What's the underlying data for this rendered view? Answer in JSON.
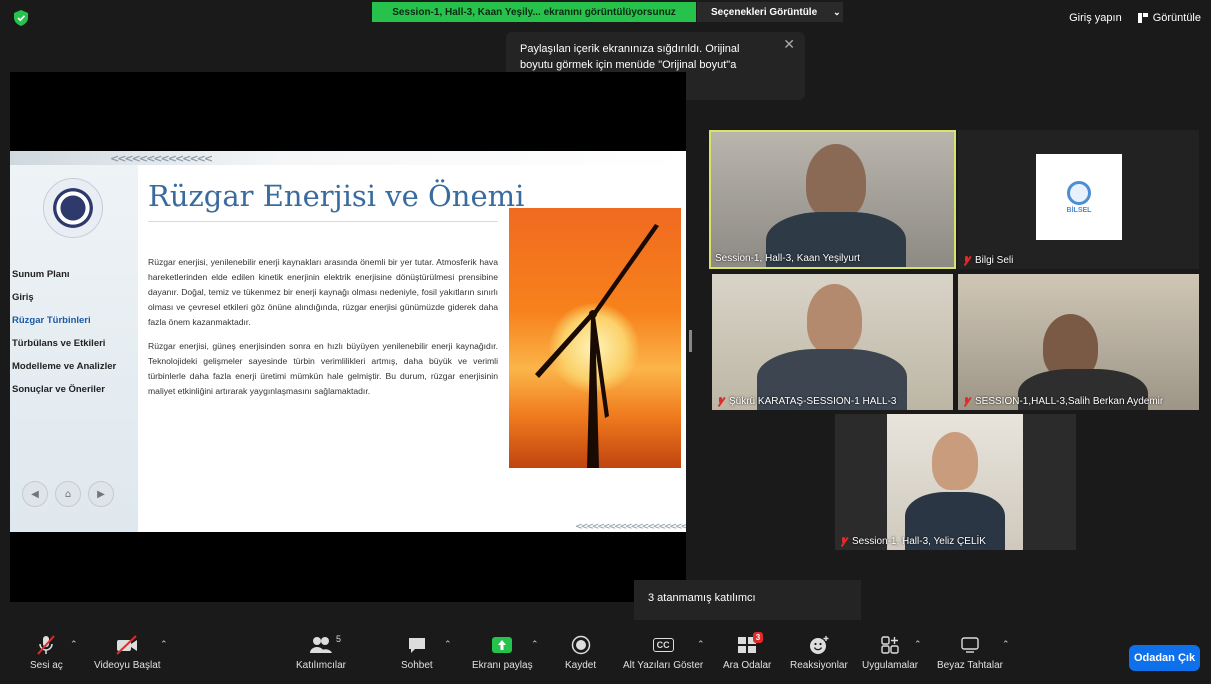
{
  "top": {
    "share_banner": "Session-1, Hall-3, Kaan Yeşily... ekranını görüntülüyorsunuz",
    "options_label": "Seçenekleri Görüntüle",
    "signin_label": "Giriş yapın",
    "view_label": "Görüntüle"
  },
  "tooltip": {
    "text": "Paylaşılan içerik ekranınıza sığdırıldı. Orijinal boyutu görmek için menüde \"Orijinal boyut\"a tıklayın."
  },
  "slide": {
    "title": "Rüzgar Enerjisi ve Önemi",
    "menu": [
      "Sunum Planı",
      "Giriş",
      "Rüzgar Türbinleri",
      "Türbülans ve Etkileri",
      "Modelleme ve Analizler",
      "Sonuçlar ve Öneriler"
    ],
    "paragraph1": "Rüzgar enerjisi, yenilenebilir enerji kaynakları arasında önemli bir yer tutar. Atmosferik hava hareketlerinden elde edilen kinetik enerjinin elektrik enerjisine dönüştürülmesi prensibine dayanır. Doğal, temiz ve tükenmez bir enerji kaynağı olması nedeniyle, fosil yakıtların sınırlı olması ve çevresel etkileri göz önüne alındığında, rüzgar enerjisi günümüzde giderek daha fazla önem kazanmaktadır.",
    "paragraph2": "Rüzgar enerjisi, güneş enerjisinden sonra en hızlı büyüyen yenilenebilir enerji kaynağıdır. Teknolojideki gelişmeler sayesinde türbin verimlilikleri artmış, daha büyük ve verimli türbinlerle daha fazla enerji üretimi mümkün hale gelmiştir. Bu durum, rüzgar enerjisinin maliyet etkinliğini artırarak yaygınlaşmasını sağlamaktadır."
  },
  "participants": [
    {
      "name": "Session-1, Hall-3, Kaan Yeşilyurt"
    },
    {
      "name": "Bilgi Seli"
    },
    {
      "name": "Şükrü KARATAŞ-SESSION-1 HALL-3"
    },
    {
      "name": "SESSION-1,HALL-3,Salih Berkan Aydemir"
    },
    {
      "name": "Session-1, Hall-3, Yeliz ÇELİK"
    }
  ],
  "bilsel_logo_text": "BİLSEL",
  "unassigned_text": "3 atanmamış katılımcı",
  "toolbar": {
    "unmute": "Sesi aç",
    "start_video": "Videoyu Başlat",
    "participants": "Katılımcılar",
    "participants_count": "5",
    "chat": "Sohbet",
    "share": "Ekranı paylaş",
    "record": "Kaydet",
    "captions": "Alt Yazıları Göster",
    "captions_icon": "CC",
    "breakout": "Ara Odalar",
    "breakout_badge": "3",
    "reactions": "Reaksiyonlar",
    "apps": "Uygulamalar",
    "whiteboard": "Beyaz Tahtalar",
    "leave": "Odadan Çık"
  },
  "colors": {
    "share_green": "#27c24c",
    "leave_blue": "#0e71eb",
    "active_border": "#d8e36a",
    "muted_red": "#e02b2b",
    "slide_title": "#3a6b9e"
  }
}
